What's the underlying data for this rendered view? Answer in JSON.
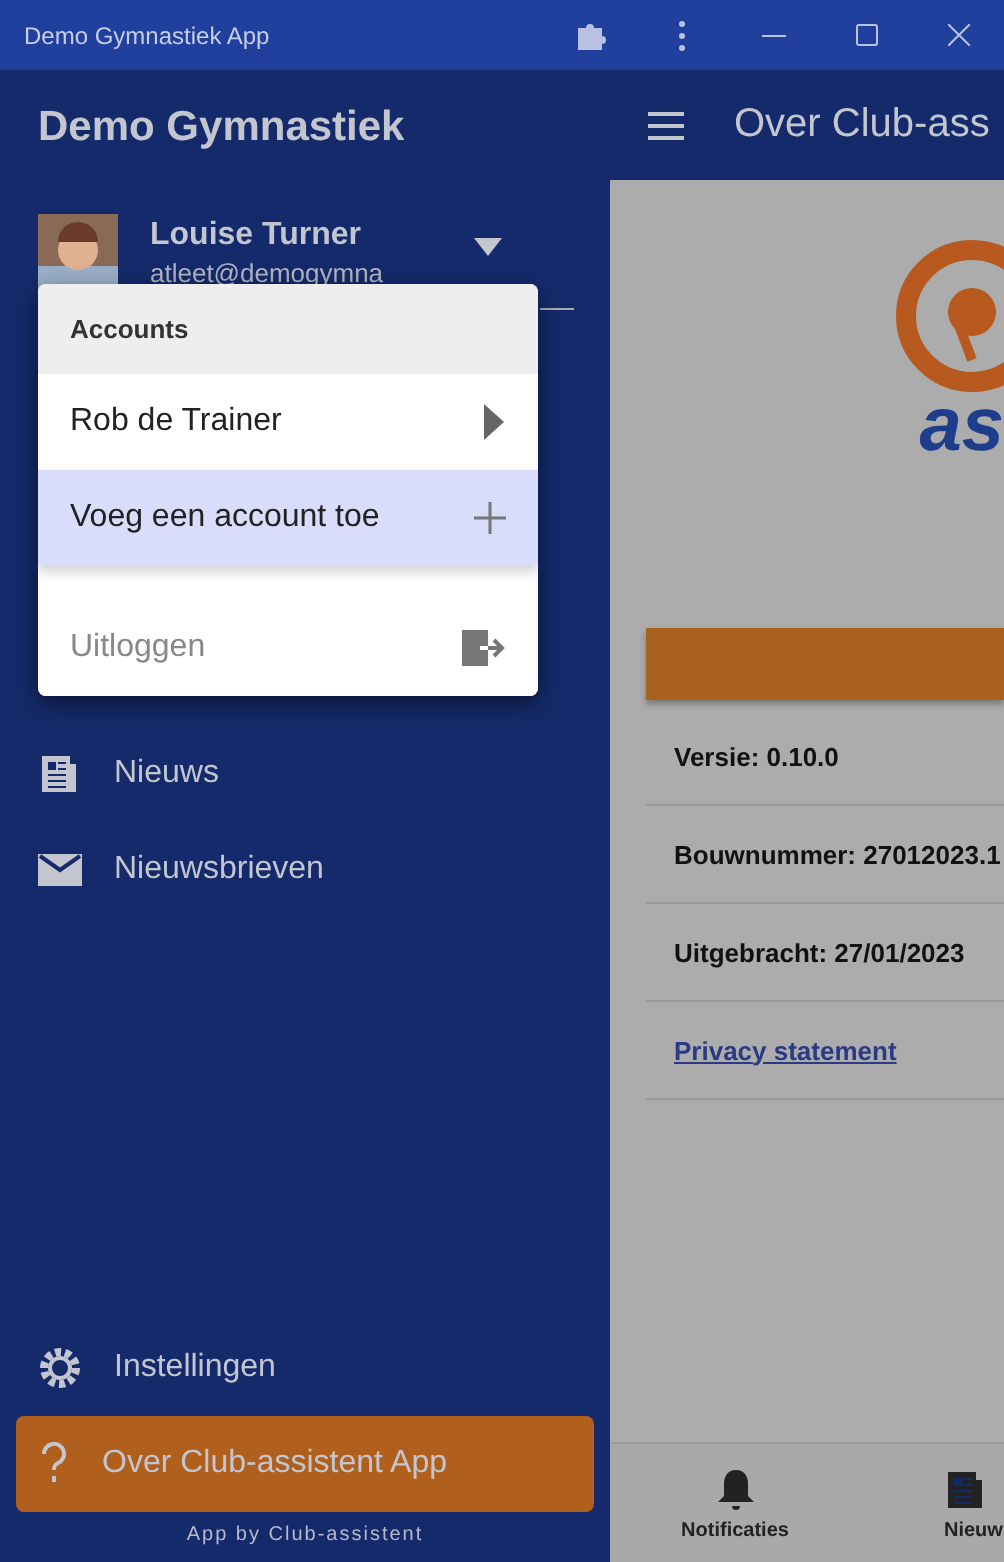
{
  "window": {
    "title": "Demo Gymnastiek App"
  },
  "drawer": {
    "title": "Demo Gymnastiek",
    "profile": {
      "name": "Louise Turner",
      "email": "atleet@demogymna"
    },
    "nav": [
      {
        "label": "Nieuws",
        "kind": "news",
        "selected": false
      },
      {
        "label": "Nieuwsbrieven",
        "kind": "mail",
        "selected": false
      }
    ],
    "bottom_nav": [
      {
        "label": "Instellingen",
        "kind": "gear",
        "selected": false
      },
      {
        "label": "Over Club-assistent App",
        "kind": "help",
        "selected": true
      }
    ],
    "footer": "App by Club-assistent"
  },
  "account_menu": {
    "header": "Accounts",
    "items": [
      {
        "label": "Rob de Trainer",
        "kind": "play",
        "selected": false,
        "disabled": false
      },
      {
        "label": "Voeg een account toe",
        "kind": "plus",
        "selected": true,
        "disabled": false
      },
      {
        "label": "Uitloggen",
        "kind": "logout",
        "selected": false,
        "disabled": true
      }
    ]
  },
  "app_bar": {
    "title": "Over Club-ass"
  },
  "about": {
    "logo_text": "as",
    "rows": [
      {
        "kind": "text",
        "text": "Versie: 0.10.0"
      },
      {
        "kind": "text",
        "text": "Bouwnummer: 27012023.1"
      },
      {
        "kind": "text",
        "text": "Uitgebracht: 27/01/2023"
      },
      {
        "kind": "link",
        "text": "Privacy statement"
      }
    ]
  },
  "tabs": [
    {
      "label": "Notificaties",
      "kind": "bell",
      "selected": false
    },
    {
      "label": "Nieuw",
      "kind": "news",
      "selected": false
    }
  ]
}
